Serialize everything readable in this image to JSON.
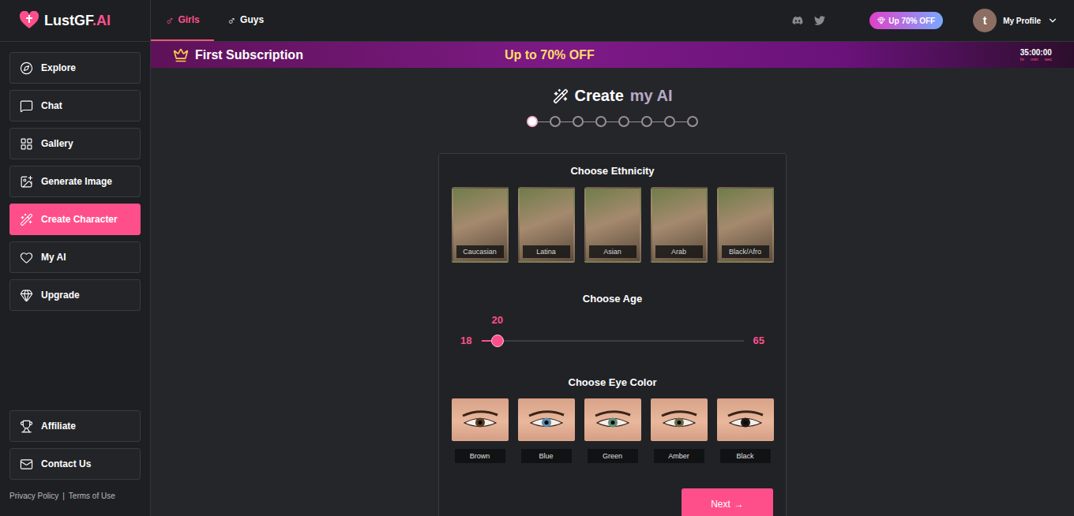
{
  "logo": {
    "name": "LustGF",
    "suffix": ".AI"
  },
  "top_tabs": [
    {
      "label": "Girls",
      "icon": "♂",
      "selected": true
    },
    {
      "label": "Guys",
      "icon": "♂",
      "selected": false
    }
  ],
  "promo_button": "Up 70% OFF",
  "profile": {
    "initial": "t",
    "label": "My Profile"
  },
  "sidebar": {
    "items": [
      {
        "label": "Explore",
        "selected": false
      },
      {
        "label": "Chat",
        "selected": false
      },
      {
        "label": "Gallery",
        "selected": false
      },
      {
        "label": "Generate Image",
        "selected": false
      },
      {
        "label": "Create Character",
        "selected": true
      },
      {
        "label": "My AI",
        "selected": false
      },
      {
        "label": "Upgrade",
        "selected": false
      }
    ],
    "bottom_items": [
      {
        "label": "Affiliate",
        "selected": false
      },
      {
        "label": "Contact Us",
        "selected": false
      }
    ],
    "footer_links": [
      "Privacy Policy",
      "Terms of Use"
    ],
    "footer_separator": "|"
  },
  "banner": {
    "title": "First Subscription",
    "offer": "Up to 70% OFF",
    "timer": "35:00:00",
    "units": [
      "hr",
      "min",
      "sec"
    ]
  },
  "page": {
    "title": "Create",
    "title_accent": "my AI"
  },
  "steps": [
    {
      "selected": true
    },
    {
      "selected": false
    },
    {
      "selected": false
    },
    {
      "selected": false
    },
    {
      "selected": false
    },
    {
      "selected": false
    },
    {
      "selected": false
    },
    {
      "selected": false
    }
  ],
  "ethnicity": {
    "title": "Choose Ethnicity",
    "options": [
      {
        "label": "Caucasian",
        "selected": false
      },
      {
        "label": "Latina",
        "selected": false
      },
      {
        "label": "Asian",
        "selected": false
      },
      {
        "label": "Arab",
        "selected": false
      },
      {
        "label": "Black/Afro",
        "selected": false
      }
    ]
  },
  "age": {
    "title": "Choose Age",
    "min": "18",
    "max": "65",
    "value": "20",
    "level": 0.043
  },
  "eye_color": {
    "title": "Choose Eye Color",
    "options": [
      {
        "label": "Brown",
        "color": "#5a3a22",
        "selected": false
      },
      {
        "label": "Blue",
        "color": "#5d8bb0",
        "selected": false
      },
      {
        "label": "Green",
        "color": "#5f8c7a",
        "selected": false
      },
      {
        "label": "Amber",
        "color": "#6e6b47",
        "selected": false
      },
      {
        "label": "Black",
        "color": "#1d1917",
        "selected": false
      }
    ]
  },
  "next_button": {
    "label": "Next",
    "arrow": "→"
  }
}
